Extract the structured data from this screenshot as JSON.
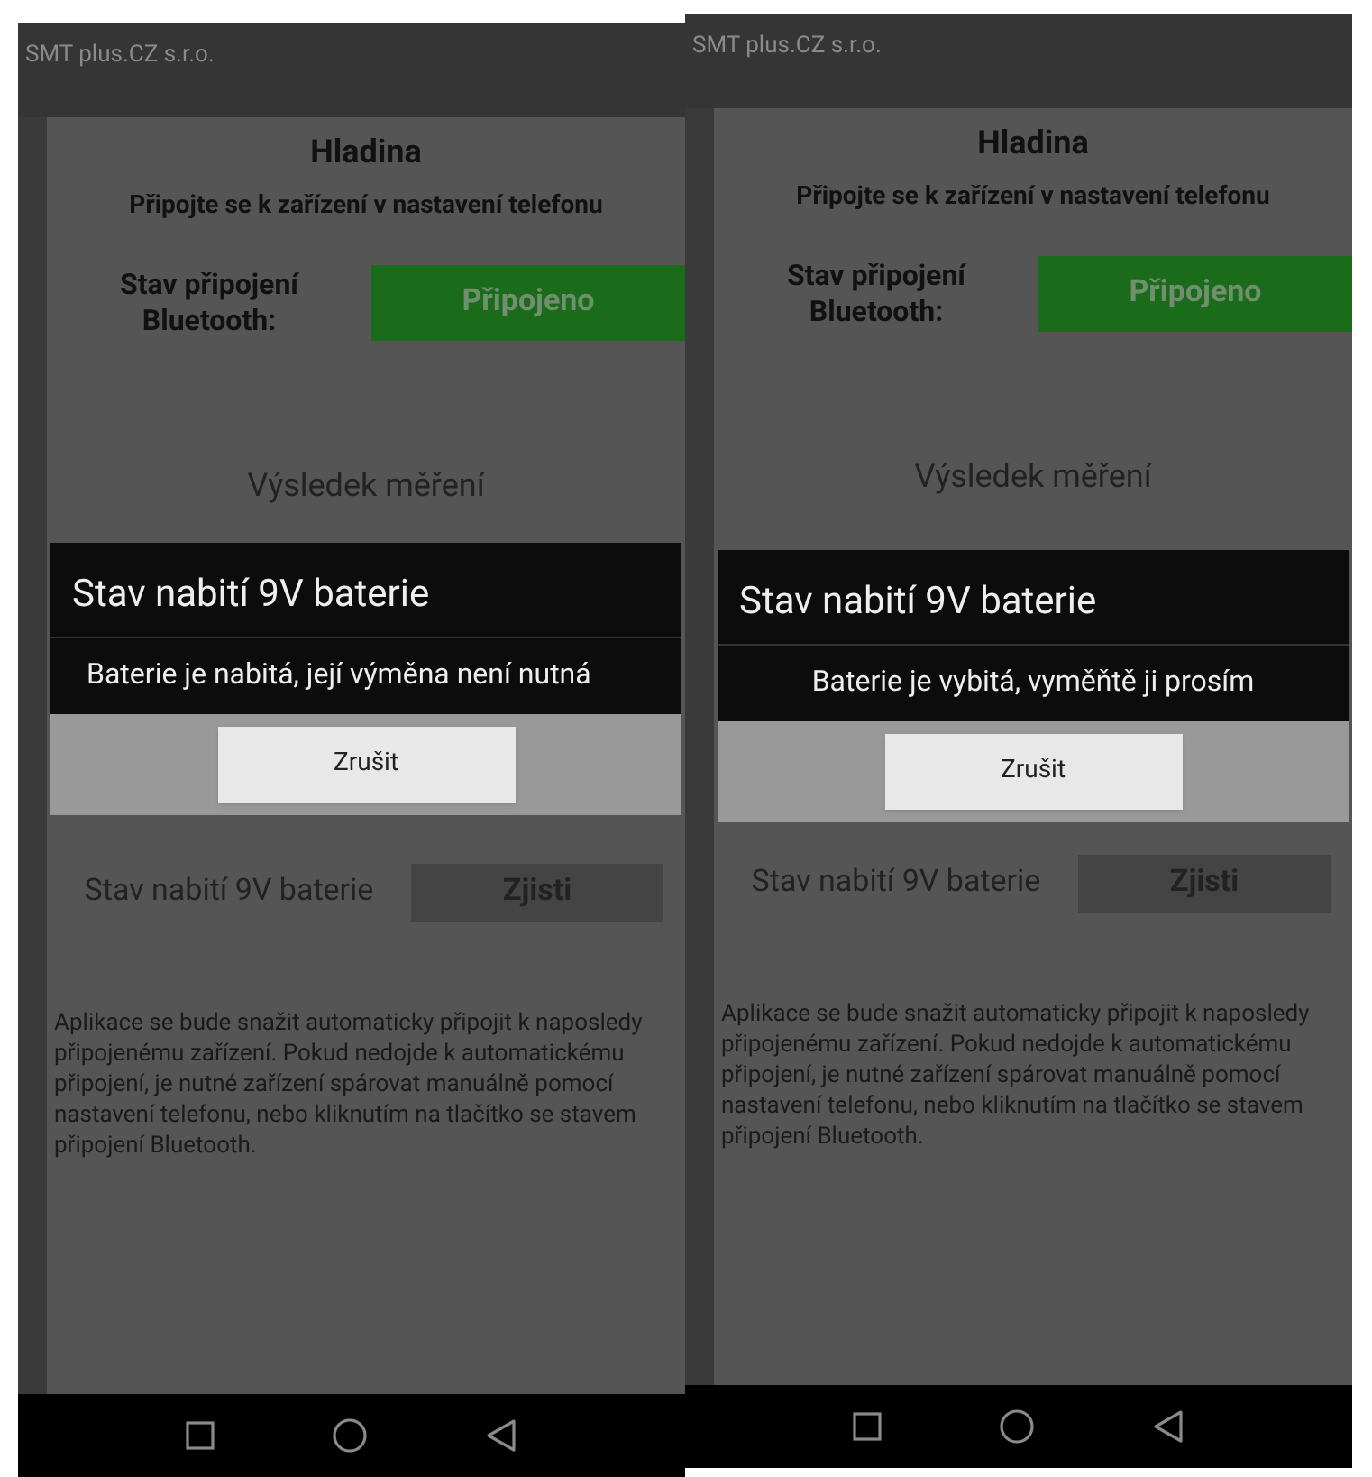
{
  "phones": [
    {
      "app_bar": {
        "title": "SMT plus.CZ s.r.o."
      },
      "heading": "Hladina",
      "subheading": "Připojte se k zařízení v nastavení telefonu",
      "bluetooth": {
        "label": "Stav připojení Bluetooth:",
        "status": "Připojeno",
        "connected": true
      },
      "result_title": "Výsledek měření",
      "battery_row": {
        "label": "Stav nabití 9V baterie",
        "button": "Zjisti"
      },
      "info": "Aplikace se bude snažit automaticky připojit k naposledy připojenému zařízení. Pokud nedojde k automatickému připojení, je nutné zařízení spárovat manuálně pomocí nastavení telefonu, nebo kliknutím na tlačítko se stavem připojení Bluetooth.",
      "dialog": {
        "title": "Stav nabití 9V baterie",
        "message": "Baterie je nabitá, její výměna není nutná",
        "button": "Zrušit"
      }
    },
    {
      "app_bar": {
        "title": "SMT plus.CZ s.r.o."
      },
      "heading": "Hladina",
      "subheading": "Připojte se k zařízení v nastavení telefonu",
      "bluetooth": {
        "label": "Stav připojení Bluetooth:",
        "status": "Připojeno",
        "connected": true
      },
      "result_title": "Výsledek měření",
      "battery_row": {
        "label": "Stav nabití 9V baterie",
        "button": "Zjisti"
      },
      "info": "Aplikace se bude snažit automaticky připojit k naposledy připojenému zařízení. Pokud nedojde k automatickému připojení, je nutné zařízení spárovat manuálně pomocí nastavení telefonu, nebo kliknutím na tlačítko se stavem připojení Bluetooth.",
      "dialog": {
        "title": "Stav nabití 9V baterie",
        "message": "Baterie je vybitá, vyměňtě ji prosím",
        "button": "Zrušit"
      }
    }
  ]
}
